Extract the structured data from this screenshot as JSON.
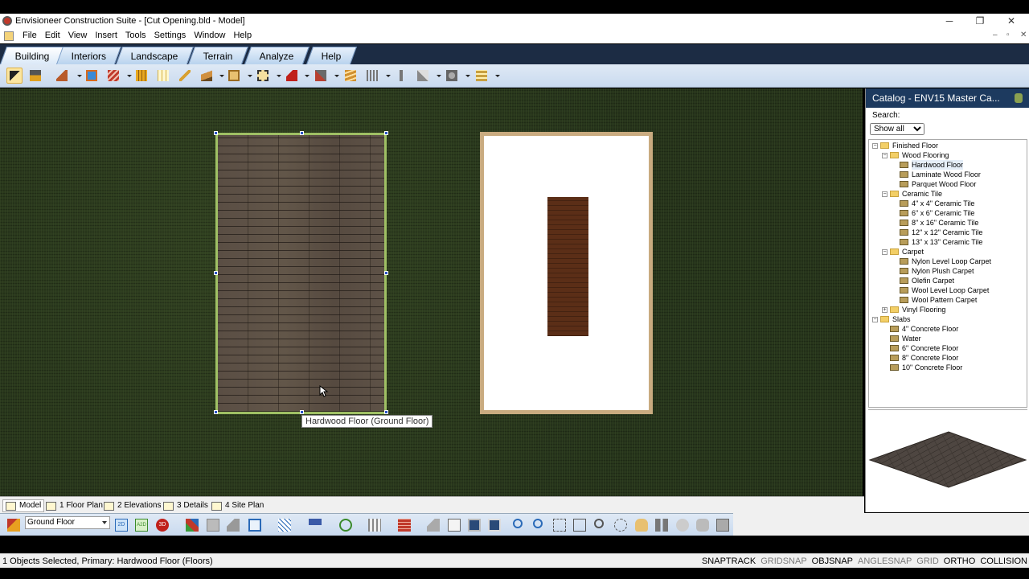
{
  "window": {
    "title": "Envisioneer Construction Suite - [Cut Opening.bld - Model]",
    "controls": [
      "─",
      "❐",
      "✕"
    ]
  },
  "menu": {
    "items": [
      "File",
      "Edit",
      "View",
      "Insert",
      "Tools",
      "Settings",
      "Window",
      "Help"
    ]
  },
  "ribbon": {
    "tabs": [
      "Building",
      "Interiors",
      "Landscape",
      "Terrain",
      "Analyze",
      "Help"
    ],
    "active": "Building"
  },
  "toolbar": {
    "icons": [
      "select-arrow-icon",
      "paintbrush-icon",
      "roof-tool-icon",
      "window-tool-icon",
      "stairs-tool-icon",
      "column-icon",
      "grid-window-icon",
      "railing-icon",
      "slab-icon",
      "cabinet-icon",
      "dimension-box-icon",
      "house-red-icon",
      "paint-fill-icon",
      "wall-tool-icon",
      "framing-icon",
      "post-icon",
      "wand-icon",
      "cog-tool-icon",
      "stack-tool-icon"
    ]
  },
  "canvas": {
    "tooltip": "Hardwood Floor (Ground Floor)",
    "colors": {
      "grass": "#25321a",
      "selection": "#9fc064",
      "handle": "#2a55c8",
      "room_wall": "#c9ab80",
      "cut_floor": "#5b2e17"
    }
  },
  "catalog": {
    "title": "Catalog - ENV15 Master Ca...",
    "search_label": "Search:",
    "filter": "Show all",
    "tree": [
      {
        "label": "Finished Floor",
        "level": 0,
        "type": "folder",
        "expander": "−"
      },
      {
        "label": "Wood Flooring",
        "level": 1,
        "type": "folder",
        "expander": "−"
      },
      {
        "label": "Hardwood Floor",
        "level": 2,
        "type": "mat",
        "selected": true
      },
      {
        "label": "Laminate Wood Floor",
        "level": 2,
        "type": "mat"
      },
      {
        "label": "Parquet Wood Floor",
        "level": 2,
        "type": "mat"
      },
      {
        "label": "Ceramic Tile",
        "level": 1,
        "type": "folder",
        "expander": "−"
      },
      {
        "label": "4\" x 4\" Ceramic Tile",
        "level": 2,
        "type": "mat"
      },
      {
        "label": "6\" x 6\" Ceramic Tile",
        "level": 2,
        "type": "mat"
      },
      {
        "label": "8\" x 16\" Ceramic Tile",
        "level": 2,
        "type": "mat"
      },
      {
        "label": "12\" x 12\" Ceramic Tile",
        "level": 2,
        "type": "mat"
      },
      {
        "label": "13\" x 13\" Ceramic Tile",
        "level": 2,
        "type": "mat"
      },
      {
        "label": "Carpet",
        "level": 1,
        "type": "folder",
        "expander": "−"
      },
      {
        "label": "Nylon Level Loop Carpet",
        "level": 2,
        "type": "mat"
      },
      {
        "label": "Nylon Plush Carpet",
        "level": 2,
        "type": "mat"
      },
      {
        "label": "Olefin Carpet",
        "level": 2,
        "type": "mat"
      },
      {
        "label": "Wool Level Loop Carpet",
        "level": 2,
        "type": "mat"
      },
      {
        "label": "Wool Pattern Carpet",
        "level": 2,
        "type": "mat"
      },
      {
        "label": "Vinyl Flooring",
        "level": 1,
        "type": "folder",
        "expander": "+"
      },
      {
        "label": "Slabs",
        "level": 0,
        "type": "folder",
        "expander": "−"
      },
      {
        "label": "4\" Concrete Floor",
        "level": 1,
        "type": "mat"
      },
      {
        "label": "Water",
        "level": 1,
        "type": "mat"
      },
      {
        "label": "6\" Concrete Floor",
        "level": 1,
        "type": "mat"
      },
      {
        "label": "8\" Concrete Floor",
        "level": 1,
        "type": "mat"
      },
      {
        "label": "10\" Concrete Floor",
        "level": 1,
        "type": "mat"
      }
    ]
  },
  "view_tabs": [
    "Model",
    "1 Floor Plan",
    "2 Elevations",
    "3 Details",
    "4 Site Plan"
  ],
  "bottom_toolbar": {
    "floor_select": "Ground Floor",
    "icons": [
      "floor-stack-icon",
      "2d-icon",
      "a2d-icon",
      "3d-icon",
      "layers-icon",
      "monitor-icon",
      "home-3d-icon",
      "house-outline-icon",
      "hatch-icon",
      "lamp-icon",
      "render-icon",
      "columns-icon",
      "bricks-icon",
      "house-gray-icon",
      "plan-icon",
      "screen-icon",
      "screen2-icon",
      "zoom-in-icon",
      "zoom-out-icon",
      "zoom-fit-icon",
      "zoom-window-icon",
      "zoom-search-icon",
      "zoom-extents-icon",
      "pan-hand-icon",
      "walk-icon",
      "orbit-icon",
      "fly-icon",
      "tools-icon"
    ]
  },
  "status": {
    "selection_text": "1 Objects Selected, Primary: Hardwood Floor (Floors)",
    "modes": [
      {
        "label": "SNAPTRACK",
        "on": true
      },
      {
        "label": "GRIDSNAP",
        "on": false
      },
      {
        "label": "OBJSNAP",
        "on": true
      },
      {
        "label": "ANGLESNAP",
        "on": false
      },
      {
        "label": "GRID",
        "on": false
      },
      {
        "label": "ORTHO",
        "on": true
      },
      {
        "label": "COLLISION",
        "on": true
      }
    ]
  }
}
